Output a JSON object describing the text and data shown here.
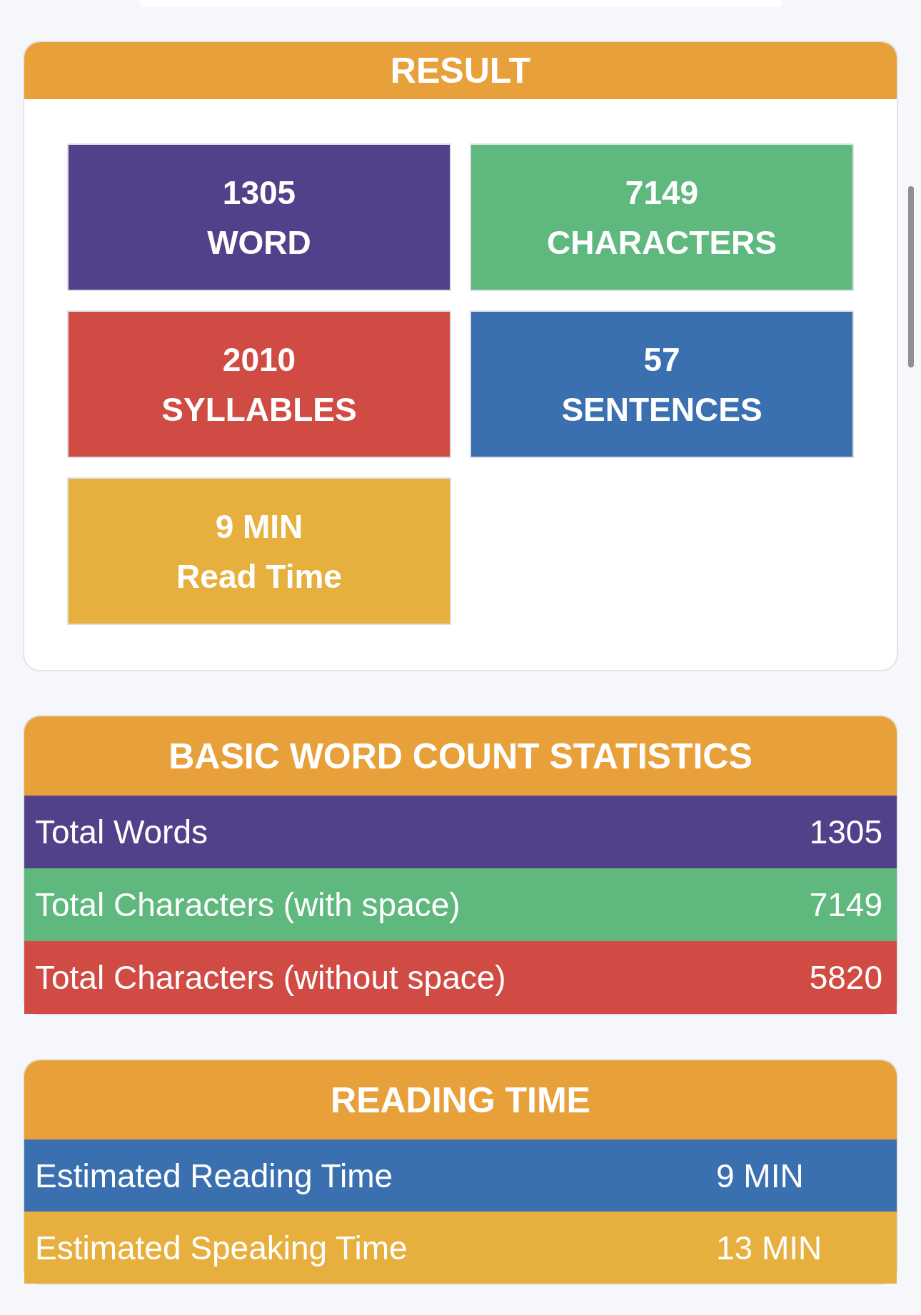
{
  "result": {
    "title": "RESULT",
    "tiles": [
      {
        "value": "1305",
        "label": "WORD",
        "color": "#52418a"
      },
      {
        "value": "7149",
        "label": "CHARACTERS",
        "color": "#5fb87e"
      },
      {
        "value": "2010",
        "label": "SYLLABLES",
        "color": "#d04b44"
      },
      {
        "value": "57",
        "label": "SENTENCES",
        "color": "#3a6fb0"
      },
      {
        "value": "9 MIN",
        "label": "Read Time",
        "color": "#e7b03e"
      }
    ]
  },
  "basic_word_count_statistics": {
    "title": "BASIC WORD COUNT STATISTICS",
    "rows": [
      {
        "label": "Total Words",
        "value": "1305",
        "color": "#52418a"
      },
      {
        "label": "Total Characters (with space)",
        "value": "7149",
        "color": "#5fb87e"
      },
      {
        "label": "Total Characters (without space)",
        "value": "5820",
        "color": "#d04b44"
      }
    ]
  },
  "reading_time": {
    "title": "READING TIME",
    "rows": [
      {
        "label": "Estimated Reading Time",
        "value": "9 MIN",
        "color": "#3a6fb0"
      },
      {
        "label": "Estimated Speaking Time",
        "value": "13 MIN",
        "color": "#e7b03e"
      }
    ]
  }
}
